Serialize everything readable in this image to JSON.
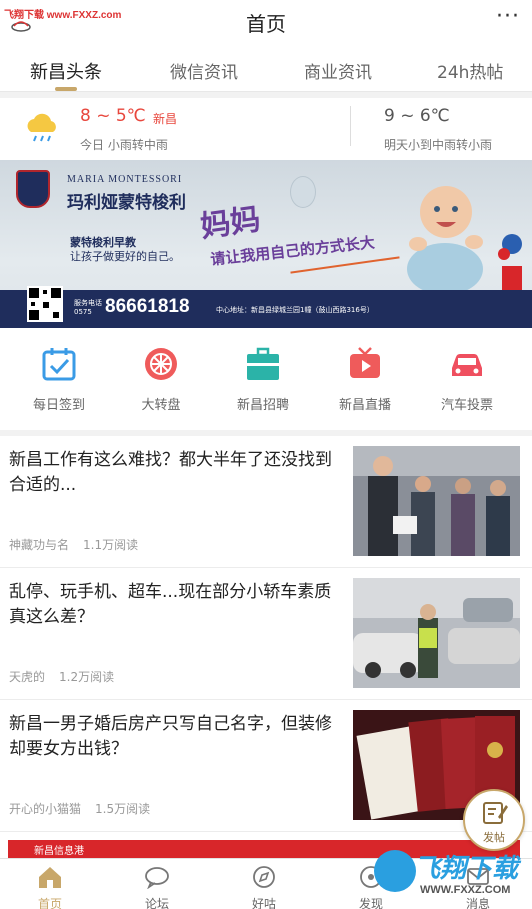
{
  "watermark_top": "飞翔下载 www.FXXZ.com",
  "header": {
    "title": "首页",
    "more": "···"
  },
  "tabs": [
    {
      "label": "新昌头条",
      "active": true
    },
    {
      "label": "微信资讯"
    },
    {
      "label": "商业资讯"
    },
    {
      "label": "24h热帖"
    }
  ],
  "weather": {
    "today_temp": "8 ~ 5℃",
    "location": "新昌",
    "today_desc": "今日 小雨转中雨",
    "tomorrow_temp": "9 ~ 6℃",
    "tomorrow_desc": "明天小到中雨转小雨"
  },
  "banner": {
    "brand_en": "MARIA MONTESSORI",
    "brand_cn": "玛利娅蒙特梭利",
    "slogan1": "蒙特梭利早教",
    "slogan2": "让孩子做更好的自己。",
    "headline": "妈妈",
    "tagline": "请让我用自己的方式长大",
    "tel_label": "服务电话\n0575",
    "tel": "86661818",
    "address": "中心地址：新昌县绿城兰园1幢（鼓山西路316号）"
  },
  "quick_icons": [
    {
      "label": "每日签到",
      "icon": "calendar-check-icon",
      "color": "#3a9be6"
    },
    {
      "label": "大转盘",
      "icon": "wheel-icon",
      "color": "#ef5b5b"
    },
    {
      "label": "新昌招聘",
      "icon": "briefcase-icon",
      "color": "#2bb3a8"
    },
    {
      "label": "新昌直播",
      "icon": "tv-play-icon",
      "color": "#ef5b5b"
    },
    {
      "label": "汽车投票",
      "icon": "car-icon",
      "color": "#ef4f5f"
    }
  ],
  "news": [
    {
      "title": "新昌工作有这么难找？都大半年了还没找到合适的...",
      "author": "神藏功与名",
      "reads": "1.1万阅读"
    },
    {
      "title": "乱停、玩手机、超车...现在部分小轿车素质真这么差？",
      "author": "天虎的",
      "reads": "1.2万阅读"
    },
    {
      "title": "新昌一男子婚后房产只写自己名字，但装修却要女方出钱？",
      "author": "开心的小猫猫",
      "reads": "1.5万阅读"
    }
  ],
  "ad_strip": "新昌信息港",
  "fab": {
    "label": "发帖",
    "icon": "post-edit-icon"
  },
  "bottom_nav": [
    {
      "label": "首页",
      "icon": "home-icon",
      "active": true
    },
    {
      "label": "论坛",
      "icon": "chat-bubble-icon"
    },
    {
      "label": "好咕",
      "icon": "compass-icon"
    },
    {
      "label": "发现",
      "icon": "discover-icon"
    },
    {
      "label": "消息",
      "icon": "message-icon"
    }
  ],
  "watermark": {
    "brand": "飞翔下载",
    "url": "WWW.FXXZ.COM"
  },
  "accent": "#c8a76a"
}
